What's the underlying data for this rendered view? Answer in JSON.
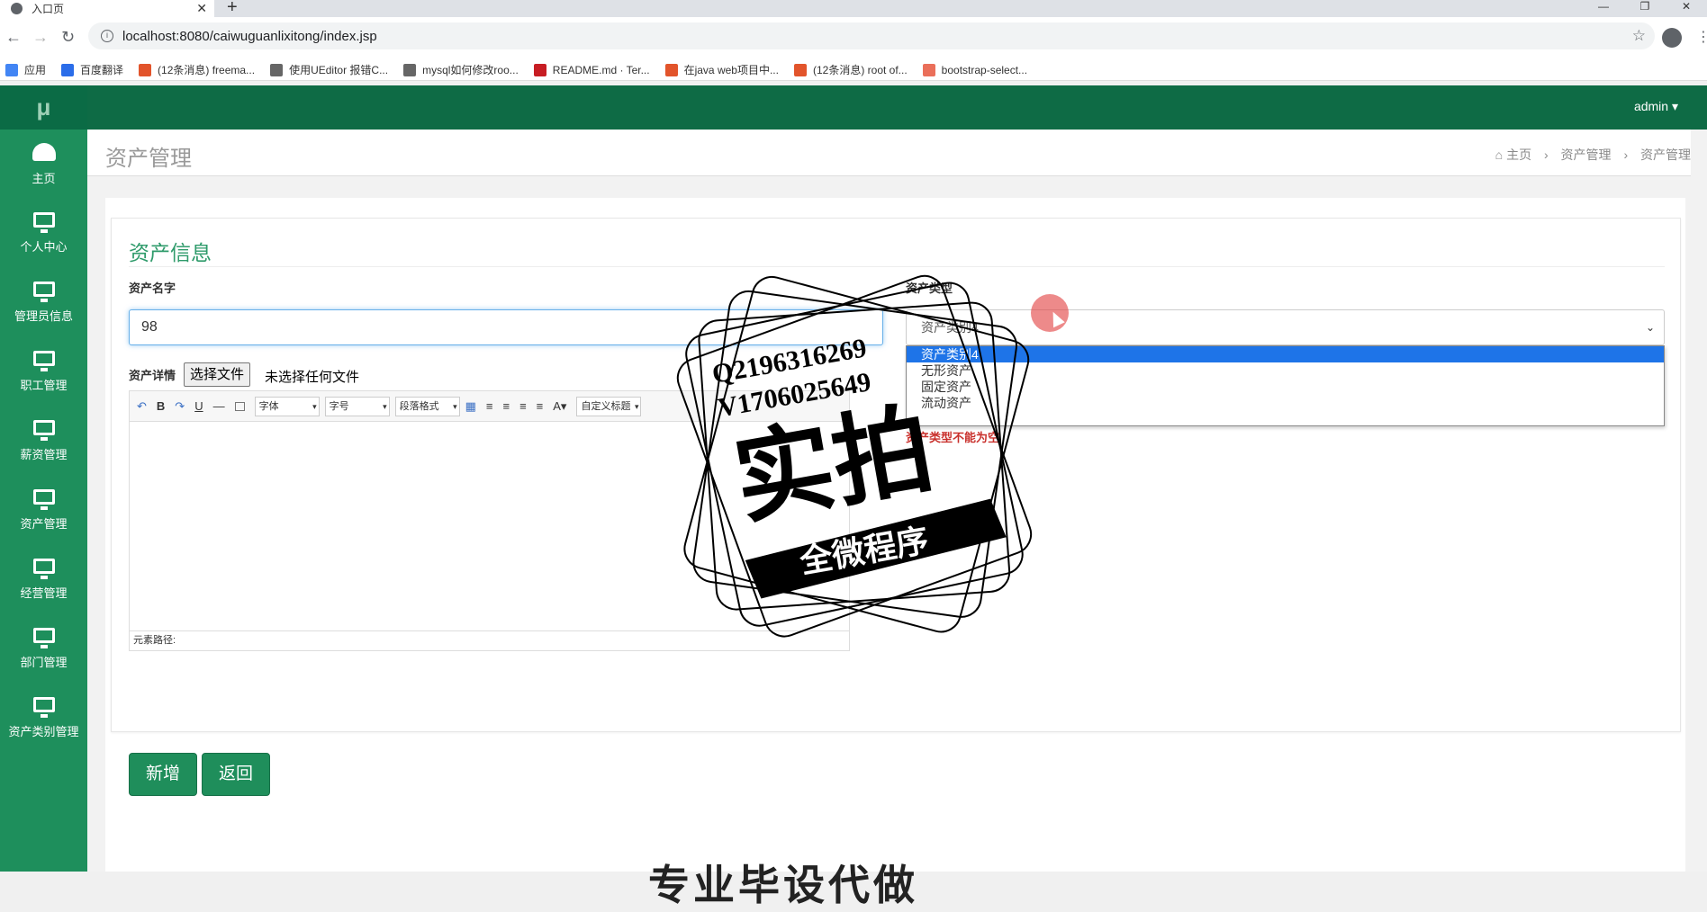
{
  "browser": {
    "tab_title": "入口页",
    "tab_close": "✕",
    "new_tab": "+",
    "url": "localhost:8080/caiwuguanlixitong/index.jsp",
    "win_min": "—",
    "win_max": "❐",
    "win_close": "✕",
    "bookmarks": [
      {
        "label": "应用",
        "icon": "apps-icon",
        "color": "#4285f4"
      },
      {
        "label": "百度翻译",
        "icon": "translate-icon",
        "color": "#2b6de9"
      },
      {
        "label": "(12条消息) freema...",
        "icon": "csdn-icon",
        "color": "#e2542b"
      },
      {
        "label": "使用UEditor 报错C...",
        "icon": "bookmark-icon",
        "color": "#666666"
      },
      {
        "label": "mysql如何修改roo...",
        "icon": "bookmark-icon",
        "color": "#666666"
      },
      {
        "label": "README.md · Ter...",
        "icon": "gitee-icon",
        "color": "#c71d23"
      },
      {
        "label": "在java web项目中...",
        "icon": "csdn-icon",
        "color": "#e2542b"
      },
      {
        "label": "(12条消息) root of...",
        "icon": "csdn-icon",
        "color": "#e2542b"
      },
      {
        "label": "bootstrap-select...",
        "icon": "jianshu-icon",
        "color": "#ea6f5a"
      }
    ]
  },
  "app": {
    "logo": "μ",
    "user": "admin ▾",
    "sidebar": [
      {
        "label": "主页",
        "icon": "dashboard-icon"
      },
      {
        "label": "个人中心",
        "icon": "monitor-icon"
      },
      {
        "label": "管理员信息",
        "icon": "monitor-icon"
      },
      {
        "label": "职工管理",
        "icon": "monitor-icon"
      },
      {
        "label": "薪资管理",
        "icon": "monitor-icon"
      },
      {
        "label": "资产管理",
        "icon": "monitor-icon"
      },
      {
        "label": "经营管理",
        "icon": "monitor-icon"
      },
      {
        "label": "部门管理",
        "icon": "monitor-icon"
      },
      {
        "label": "资产类别管理",
        "icon": "monitor-icon"
      }
    ],
    "page_title": "资产管理",
    "breadcrumb": [
      "主页",
      "资产管理",
      "资产管理"
    ]
  },
  "form": {
    "card_title": "资产信息",
    "name_label": "资产名字",
    "name_value": "98",
    "type_label": "资产类型",
    "type_selected": "资产类别4",
    "type_options": [
      "资产类别4",
      "无形资产",
      "固定资产",
      "流动资产"
    ],
    "type_error": "资产类型不能为空",
    "detail_label": "资产详情",
    "file_button": "选择文件",
    "file_status": "未选择任何文件",
    "editor": {
      "font_select": "字体",
      "size_select": "字号",
      "para_select": "段落格式",
      "custom_select": "自定义标题",
      "path_label": "元素路径:"
    },
    "add_button": "新增",
    "back_button": "返回"
  },
  "watermark": {
    "qq": "Q2196316269",
    "v": "V1706025649",
    "main": "实拍",
    "ribbon": "全微程序"
  },
  "bottom_text": "专业毕设代做"
}
